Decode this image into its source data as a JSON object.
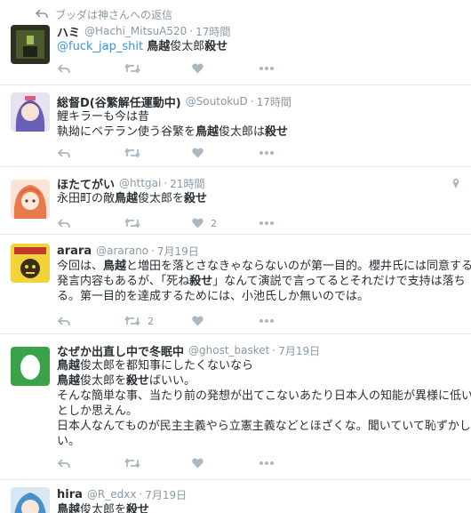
{
  "context": {
    "reply_text": "ブッダは神さんへの返信"
  },
  "tweets": [
    {
      "name": "ハミ",
      "handle": "@Hachi_MitsuA520",
      "time": "17時間",
      "lines": [
        [
          "@fuck_jap_shit ",
          "鳥越",
          "俊太郎",
          "殺せ"
        ]
      ],
      "retweets": "",
      "likes": ""
    },
    {
      "name": "総督D(谷繁解任運動中)",
      "handle": "@SoutokuD",
      "time": "17時間",
      "lines": [
        [
          "鯉キラーも今は昔"
        ],
        [
          "執拗にベテラン使う谷繁を",
          "鳥越",
          "俊太郎は",
          "殺せ"
        ]
      ],
      "retweets": "",
      "likes": ""
    },
    {
      "name": "ほたてがい",
      "handle": "@httgai",
      "time": "21時間",
      "lines": [
        [
          "永田町の敵",
          "鳥越",
          "俊太郎を",
          "殺せ"
        ]
      ],
      "retweets": "",
      "likes": "2"
    },
    {
      "name": "arara",
      "handle": "@ararano",
      "time": "7月19日",
      "lines": [
        [
          "今回は、",
          "鳥越",
          "と増田を落とさなきゃならないのが第一目的。櫻井氏には同意する"
        ],
        [
          "発言内容もあるが、「死ね",
          "殺せ",
          "」なんて演説で言ってるとそれだけで支持は落ち"
        ],
        [
          "る。第一目的を達成するためには、小池氏しか無いのでは。"
        ]
      ],
      "retweets": "2",
      "likes": ""
    },
    {
      "name": "なぜか出直し中で冬眠中",
      "handle": "@ghost_basket",
      "time": "7月19日",
      "lines": [
        [
          "鳥越",
          "俊太郎を都知事にしたくないなら"
        ],
        [
          "鳥越",
          "俊太郎を",
          "殺せ",
          "ばいい。"
        ],
        [
          "そんな簡単な事、当たり前の発想が出てこないあたり日本人の知能が異様に低い"
        ],
        [
          "としか思えん。"
        ],
        [
          "日本人なんてものが民主主義やら立憲主義などとほざくな。聞いていて恥ずかし"
        ],
        [
          "い。"
        ]
      ],
      "retweets": "",
      "likes": ""
    },
    {
      "name": "hira",
      "handle": "@R_edxx",
      "time": "7月19日",
      "lines": [
        [
          "鳥越",
          "俊太郎を",
          "殺せ"
        ]
      ],
      "retweets": "",
      "likes": ""
    }
  ],
  "icons": {
    "reply": "reply-icon",
    "retweet": "retweet-icon",
    "like": "heart-icon",
    "more": "more-icon",
    "geo": "location-pin-icon"
  },
  "colors": {
    "link": "#3b94d9",
    "muted": "#8899a6",
    "action": "#aab8c2",
    "divider": "#e1e8ed"
  }
}
